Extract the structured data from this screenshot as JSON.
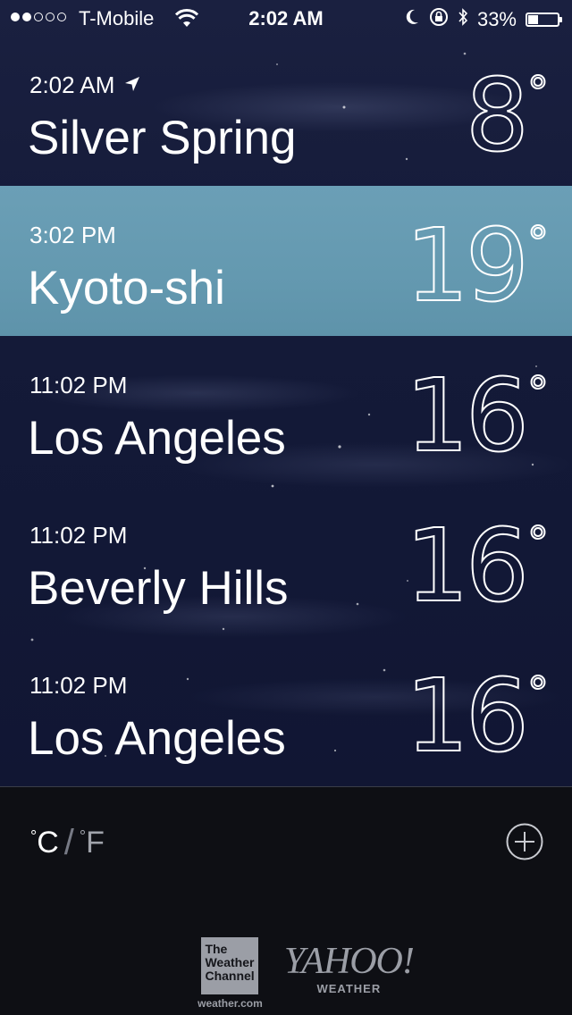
{
  "status_bar": {
    "signal_bars_filled": 2,
    "signal_bars_total": 5,
    "carrier": "T-Mobile",
    "time": "2:02 AM",
    "battery_percent": "33%",
    "battery_level": 0.33
  },
  "cities": [
    {
      "time": "2:02 AM",
      "name": "Silver Spring",
      "temp": "8",
      "deg": "°",
      "is_current_location": true,
      "selected": false
    },
    {
      "time": "3:02 PM",
      "name": "Kyoto-shi",
      "temp": "19",
      "deg": "°",
      "is_current_location": false,
      "selected": true
    },
    {
      "time": "11:02 PM",
      "name": "Los Angeles",
      "temp": "16",
      "deg": "°",
      "is_current_location": false,
      "selected": false
    },
    {
      "time": "11:02 PM",
      "name": "Beverly Hills",
      "temp": "16",
      "deg": "°",
      "is_current_location": false,
      "selected": false
    },
    {
      "time": "11:02 PM",
      "name": "Los Angeles",
      "temp": "16",
      "deg": "°",
      "is_current_location": false,
      "selected": false
    }
  ],
  "footer": {
    "unit_c": "C",
    "unit_sep": "/",
    "unit_f": "F",
    "deg": "°",
    "add_icon": "plus-circle-icon",
    "twc_lines": [
      "The",
      "Weather",
      "Channel"
    ],
    "twc_url": "weather.com",
    "yahoo_mark": "YAHOO!",
    "yahoo_sub": "WEATHER"
  },
  "colors": {
    "selected_row": "#6499b0",
    "background_top": "#1a2040",
    "footer_bg": "#0e0f14"
  }
}
